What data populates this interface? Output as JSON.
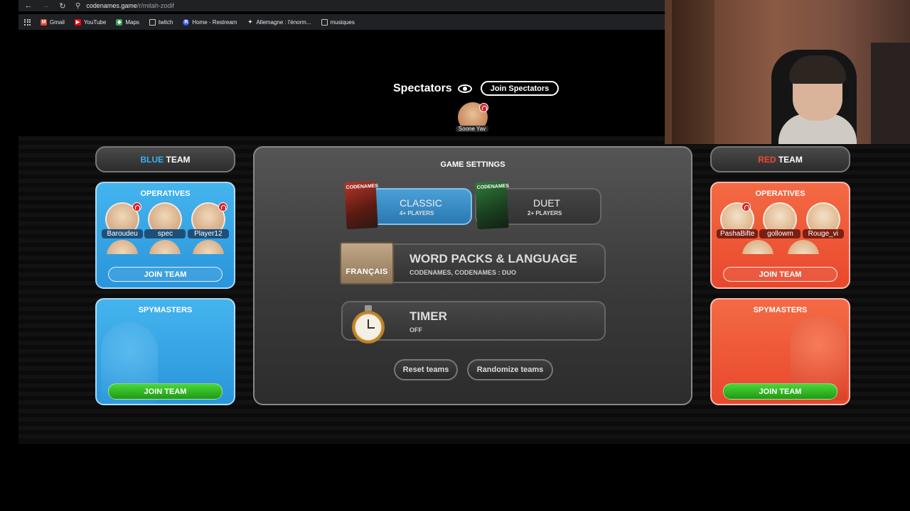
{
  "browser": {
    "url_host": "codenames.game",
    "url_path": "/r/mitah-zodif",
    "bookmarks": [
      {
        "label": "Gmail",
        "color": "#ea4335",
        "glyph": "M"
      },
      {
        "label": "YouTube",
        "color": "#ff0000",
        "glyph": "▶"
      },
      {
        "label": "Maps",
        "color": "#34a853",
        "glyph": "◆"
      },
      {
        "label": "twitch",
        "color": "",
        "glyph": "folder"
      },
      {
        "label": "Home - Restream",
        "color": "#3d5afe",
        "glyph": "R"
      },
      {
        "label": "Allemagne : l'énorm...",
        "color": "#ffffff",
        "glyph": "✦"
      },
      {
        "label": "musiques",
        "color": "",
        "glyph": "folder"
      }
    ]
  },
  "spectators": {
    "title": "Spectators",
    "join_label": "Join Spectators",
    "members": [
      {
        "name": "Soone Yav"
      }
    ]
  },
  "blue_team": {
    "accent": "BLUE",
    "label": "TEAM",
    "operatives_title": "OPERATIVES",
    "operatives": [
      "Baroudeu",
      "spec",
      "Player12"
    ],
    "join_operatives": "JOIN TEAM",
    "spymasters_title": "SPYMASTERS",
    "join_spymasters": "JOIN TEAM"
  },
  "red_team": {
    "accent": "RED",
    "label": "TEAM",
    "operatives_title": "OPERATIVES",
    "operatives": [
      "PashaBifte",
      "gollowm",
      "Rouge_vi"
    ],
    "join_operatives": "JOIN TEAM",
    "spymasters_title": "SPYMASTERS",
    "join_spymasters": "JOIN TEAM"
  },
  "settings": {
    "title": "GAME SETTINGS",
    "modes": [
      {
        "name": "CLASSIC",
        "sub": "4+ PLAYERS",
        "selected": true,
        "box_label": "CODENAMES"
      },
      {
        "name": "DUET",
        "sub": "2+ PLAYERS",
        "selected": false,
        "box_label": "CODENAMES"
      }
    ],
    "packs": {
      "title": "WORD PACKS & LANGUAGE",
      "sub": "CODENAMES, CODENAMES : DUO",
      "language_tag": "FRANÇAIS"
    },
    "timer": {
      "title": "TIMER",
      "sub": "OFF"
    },
    "reset_label": "Reset teams",
    "randomize_label": "Randomize teams"
  },
  "colors": {
    "blue": "#2a95db",
    "red": "#e8482c",
    "green": "#1f9a14"
  }
}
